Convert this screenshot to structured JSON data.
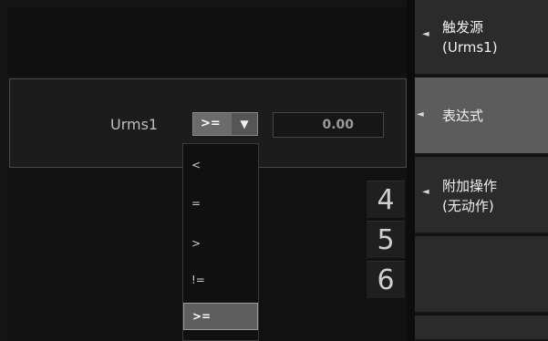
{
  "expression": {
    "label": "Urms1",
    "operator": ">=",
    "value": "0.00",
    "operator_options": [
      "<",
      "=",
      ">",
      "!=",
      ">="
    ],
    "selected_index": 4
  },
  "keypad": {
    "keys": [
      "4",
      "5",
      "6"
    ]
  },
  "menu": {
    "items": [
      {
        "line1": "触发源",
        "line2": "(Urms1)",
        "active": false
      },
      {
        "line1": "表达式",
        "line2": "",
        "active": true
      },
      {
        "line1": "附加操作",
        "line2": "(无动作)",
        "active": false
      },
      {
        "line1": "",
        "line2": "",
        "active": false
      },
      {
        "line1": "",
        "line2": "",
        "active": false
      }
    ]
  },
  "icons": {
    "menu_arrow": "◄",
    "dropdown_arrow": "▼"
  }
}
